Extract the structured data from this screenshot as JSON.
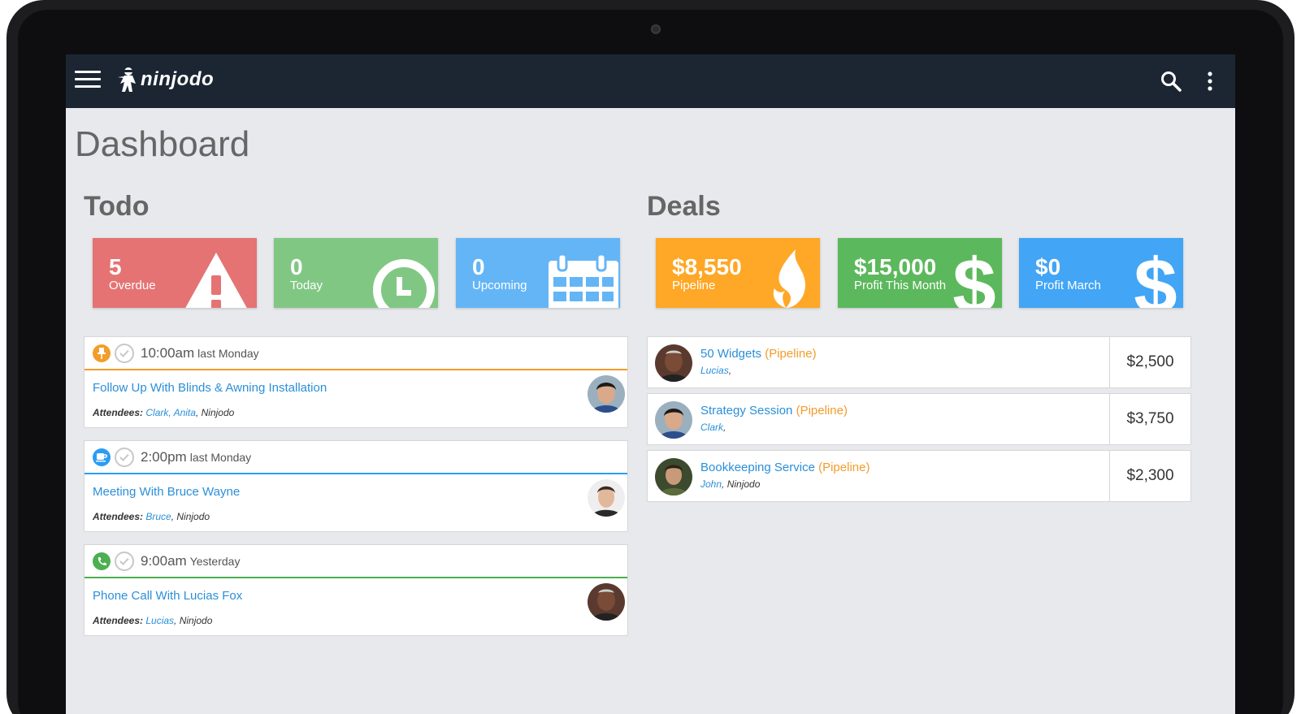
{
  "app": {
    "name": "ninjodo"
  },
  "page": {
    "title": "Dashboard"
  },
  "todo": {
    "title": "Todo",
    "tiles": [
      {
        "value": "5",
        "label": "Overdue",
        "color": "#e57373",
        "icon": "warning-icon"
      },
      {
        "value": "0",
        "label": "Today",
        "color": "#81c784",
        "icon": "clock-icon"
      },
      {
        "value": "0",
        "label": "Upcoming",
        "color": "#64b5f6",
        "icon": "calendar-icon"
      }
    ],
    "items": [
      {
        "time": "10:00am",
        "when": "last Monday",
        "title": "Follow Up With Blinds & Awning Installation",
        "attendees_label": "Attendees:",
        "attendees_links": "Clark, Anita",
        "attendees_rest": ", Ninjodo",
        "type_icon": "pin-icon",
        "accent": "#f39c2a"
      },
      {
        "time": "2:00pm",
        "when": "last Monday",
        "title": "Meeting With Bruce Wayne",
        "attendees_label": "Attendees:",
        "attendees_links": "Bruce",
        "attendees_rest": ", Ninjodo",
        "type_icon": "coffee-icon",
        "accent": "#2a9df4"
      },
      {
        "time": "9:00am",
        "when": "Yesterday",
        "title": "Phone Call With Lucias Fox",
        "attendees_label": "Attendees:",
        "attendees_links": "Lucias",
        "attendees_rest": ", Ninjodo",
        "type_icon": "phone-icon",
        "accent": "#4caf50"
      }
    ]
  },
  "deals": {
    "title": "Deals",
    "tiles": [
      {
        "value": "$8,550",
        "label": "Pipeline",
        "color": "#ffa726",
        "icon": "flame-icon"
      },
      {
        "value": "$15,000",
        "label": "Profit This Month",
        "color": "#5cb85c",
        "icon": "dollar-icon"
      },
      {
        "value": "$0",
        "label": "Profit March",
        "color": "#42a5f5",
        "icon": "dollar-icon"
      }
    ],
    "items": [
      {
        "name": "50 Widgets",
        "stage": "(Pipeline)",
        "people_links": "Lucias",
        "people_rest": ",",
        "amount": "$2,500"
      },
      {
        "name": "Strategy Session",
        "stage": "(Pipeline)",
        "people_links": "Clark",
        "people_rest": ",",
        "amount": "$3,750"
      },
      {
        "name": "Bookkeeping Service",
        "stage": "(Pipeline)",
        "people_links": "John",
        "people_rest": ", Ninjodo",
        "amount": "$2,300"
      }
    ]
  }
}
